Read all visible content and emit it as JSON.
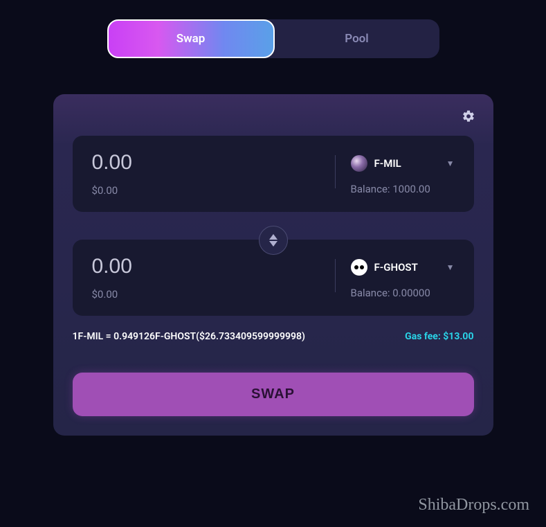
{
  "tabs": {
    "swap": "Swap",
    "pool": "Pool"
  },
  "from": {
    "amount": "0.00",
    "usd": "$0.00",
    "token": "F-MIL",
    "balance_label": "Balance: 1000.00"
  },
  "to": {
    "amount": "0.00",
    "usd": "$0.00",
    "token": "F-GHOST",
    "balance_label": "Balance: 0.00000"
  },
  "rate": "1F-MIL = 0.949126F-GHOST($26.733409599999998)",
  "gas": "Gas fee: $13.00",
  "swap_button": "SWAP",
  "watermark": "ShibaDrops.com"
}
